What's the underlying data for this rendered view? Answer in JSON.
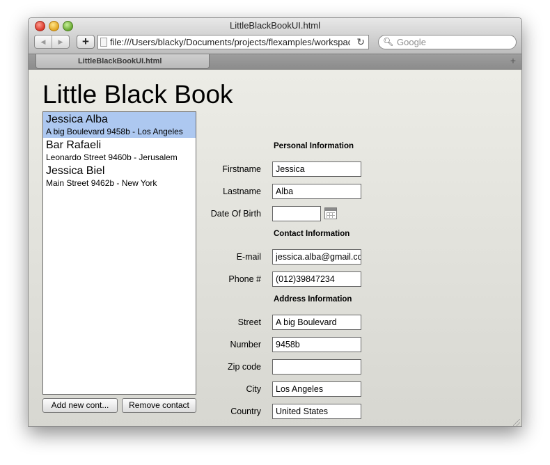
{
  "window": {
    "title": "LittleBlackBookUI.html",
    "url": "file:///Users/blacky/Documents/projects/flexamples/workspace",
    "search_placeholder": "Google",
    "tab_label": "LittleBlackBookUI.html"
  },
  "app": {
    "title": "Little Black Book",
    "contacts": [
      {
        "name": "Jessica Alba",
        "address": "A big Boulevard 9458b - Los Angeles"
      },
      {
        "name": "Bar Rafaeli",
        "address": "Leonardo Street 9460b - Jerusalem"
      },
      {
        "name": "Jessica Biel",
        "address": "Main Street 9462b - New York"
      }
    ],
    "add_button": "Add new cont...",
    "remove_button": "Remove contact"
  },
  "form": {
    "personal_header": "Personal Information",
    "contact_header": "Contact Information",
    "address_header": "Address Information",
    "labels": {
      "firstname": "Firstname",
      "lastname": "Lastname",
      "dob": "Date Of Birth",
      "email": "E-mail",
      "phone": "Phone #",
      "street": "Street",
      "number": "Number",
      "zip": "Zip code",
      "city": "City",
      "country": "Country"
    },
    "values": {
      "firstname": "Jessica",
      "lastname": "Alba",
      "dob": "",
      "email": "jessica.alba@gmail.com",
      "phone": "(012)39847234",
      "street": "A big Boulevard",
      "number": "9458b",
      "zip": "",
      "city": "Los Angeles",
      "country": "United States"
    }
  },
  "colors": {
    "selection": "#adc8f0",
    "background": "#e4e4de"
  }
}
